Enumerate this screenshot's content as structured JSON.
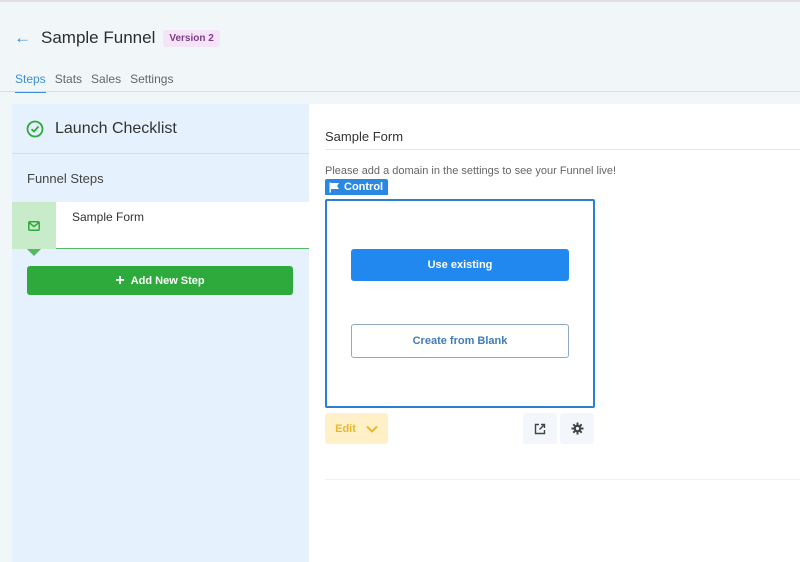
{
  "header": {
    "back_icon": "arrow-left-icon",
    "title": "Sample Funnel",
    "version_badge": "Version 2"
  },
  "tabs": [
    {
      "label": "Steps",
      "active": true
    },
    {
      "label": "Stats",
      "active": false
    },
    {
      "label": "Sales",
      "active": false
    },
    {
      "label": "Settings",
      "active": false
    }
  ],
  "sidebar": {
    "checklist_label": "Launch Checklist",
    "funnel_steps_title": "Funnel Steps",
    "steps": [
      {
        "label": "Sample Form",
        "icon": "envelope-icon",
        "selected": true
      }
    ],
    "add_step_label": "Add New Step"
  },
  "main": {
    "title": "Sample Form",
    "notice": "Please add a domain in the settings to see your Funnel live!",
    "control_tag": "Control",
    "use_existing_label": "Use existing",
    "create_blank_label": "Create from Blank",
    "edit_label": "Edit"
  },
  "colors": {
    "accent_blue": "#2188f0",
    "success_green": "#2eaa3c",
    "edit_yellow": "#fff0c8",
    "badge_purple": "#f5e3f7"
  }
}
